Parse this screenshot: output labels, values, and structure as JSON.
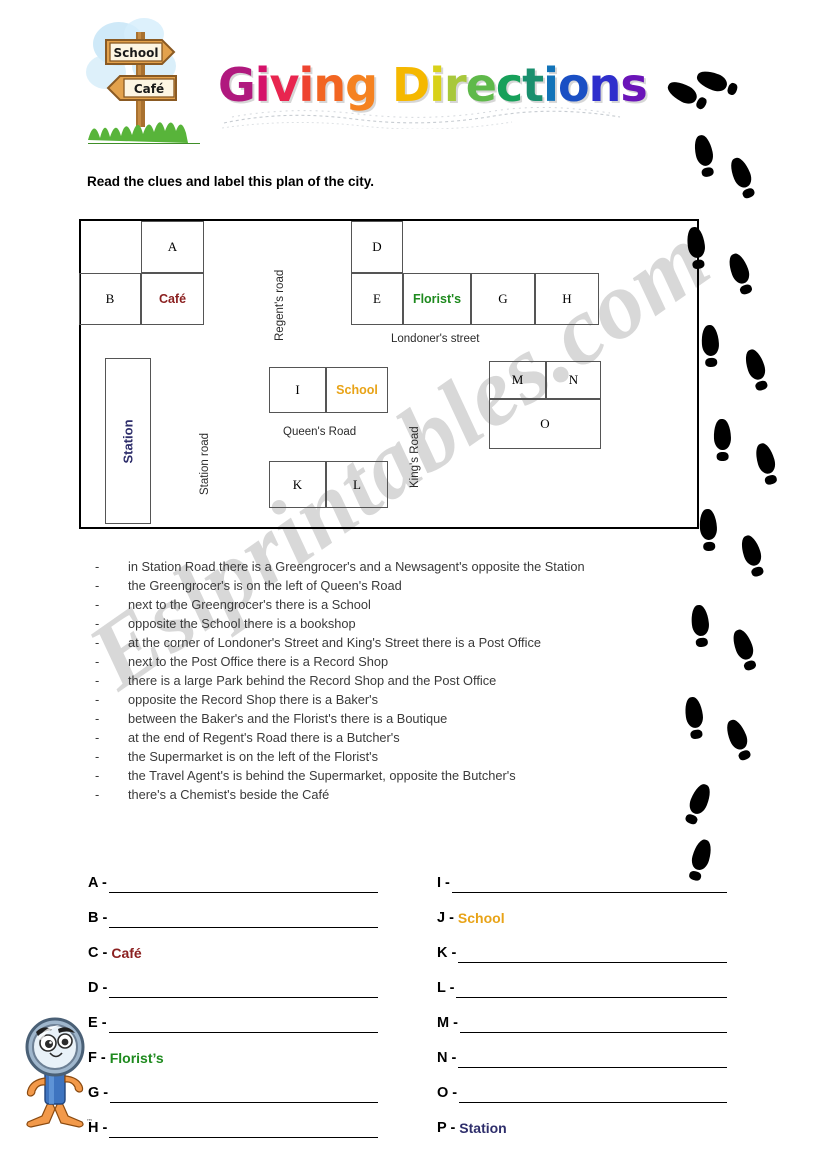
{
  "page": {
    "watermark_text": "Eslprintables.com"
  },
  "header": {
    "title": "Giving Directions",
    "title_letters": [
      {
        "ch": "G",
        "color": "#B0197E"
      },
      {
        "ch": "i",
        "color": "#D5126A"
      },
      {
        "ch": "v",
        "color": "#E8254F"
      },
      {
        "ch": "i",
        "color": "#EE4430"
      },
      {
        "ch": "n",
        "color": "#F26522"
      },
      {
        "ch": "g",
        "color": "#F58220"
      },
      {
        "ch": " ",
        "color": "#FFFFFF"
      },
      {
        "ch": "D",
        "color": "#F5B800"
      },
      {
        "ch": "i",
        "color": "#D8D119"
      },
      {
        "ch": "r",
        "color": "#A8C83C"
      },
      {
        "ch": "e",
        "color": "#5FB94A"
      },
      {
        "ch": "c",
        "color": "#17A05A"
      },
      {
        "ch": "t",
        "color": "#1A8F6E"
      },
      {
        "ch": "i",
        "color": "#1273B8"
      },
      {
        "ch": "o",
        "color": "#1A4FC4"
      },
      {
        "ch": "n",
        "color": "#2E2ECC"
      },
      {
        "ch": "s",
        "color": "#6A14B8"
      }
    ],
    "signpost": {
      "top_sign": "School",
      "bottom_sign": "Café"
    }
  },
  "instruction": "Read the clues and label this plan of the city.",
  "map": {
    "roads": [
      {
        "name": "Regent's road",
        "orientation": "vertical"
      },
      {
        "name": "Londoner's street",
        "orientation": "horizontal"
      },
      {
        "name": "Station road",
        "orientation": "vertical"
      },
      {
        "name": "Queen's Road",
        "orientation": "horizontal"
      },
      {
        "name": "King's Road",
        "orientation": "vertical"
      }
    ],
    "blocks": {
      "a": "A",
      "b": "B",
      "cafe": "Café",
      "d": "D",
      "e": "E",
      "florists": "Florist's",
      "g": "G",
      "h": "H",
      "i": "I",
      "school": "School",
      "k": "K",
      "l": "L",
      "m": "M",
      "n": "N",
      "o": "O",
      "station": "Station"
    },
    "colors": {
      "cafe": "#8B2020",
      "florists": "#1E8A1E",
      "school": "#E8A317",
      "station": "#2E2E6B"
    }
  },
  "clues": {
    "bullet": "-",
    "items": [
      "in Station Road there is a Greengrocer's and a Newsagent's opposite the Station",
      "the Greengrocer's is on the left of Queen's Road",
      "next to the Greengrocer's there is a School",
      "opposite the School there is a bookshop",
      "at the corner of Londoner's Street and King's Street there is a Post Office",
      "next to the Post Office there is a Record Shop",
      "there is a large Park behind the Record Shop and the Post Office",
      "opposite the Record Shop there is a Baker's",
      "between the Baker's and the Florist's there is a Boutique",
      "at the end of Regent's Road there is a Butcher's",
      "the Supermarket is on the left of the Florist's",
      "the Travel Agent's is behind the Supermarket, opposite the Butcher's",
      "there's a Chemist's beside the Café"
    ]
  },
  "answers": {
    "left": [
      {
        "letter": "A -",
        "value": "",
        "color": "#000000"
      },
      {
        "letter": "B -",
        "value": "",
        "color": "#000000"
      },
      {
        "letter": "C -",
        "value": "Café",
        "color": "#8B2020"
      },
      {
        "letter": "D -",
        "value": "",
        "color": "#000000"
      },
      {
        "letter": "E -",
        "value": "",
        "color": "#000000"
      },
      {
        "letter": "F -",
        "value": "Florist’s",
        "color": "#1E8A1E"
      },
      {
        "letter": "G -",
        "value": "",
        "color": "#000000"
      },
      {
        "letter": "H -",
        "value": "",
        "color": "#000000"
      }
    ],
    "right": [
      {
        "letter": "I -",
        "value": "",
        "color": "#000000"
      },
      {
        "letter": "J -",
        "value": "School",
        "color": "#E8A317"
      },
      {
        "letter": "K -",
        "value": "",
        "color": "#000000"
      },
      {
        "letter": "L -",
        "value": "",
        "color": "#000000"
      },
      {
        "letter": "M -",
        "value": "",
        "color": "#000000"
      },
      {
        "letter": "N -",
        "value": "",
        "color": "#000000"
      },
      {
        "letter": "O -",
        "value": "",
        "color": "#000000"
      },
      {
        "letter": "P -",
        "value": "Station",
        "color": "#2E2E6B"
      }
    ]
  }
}
